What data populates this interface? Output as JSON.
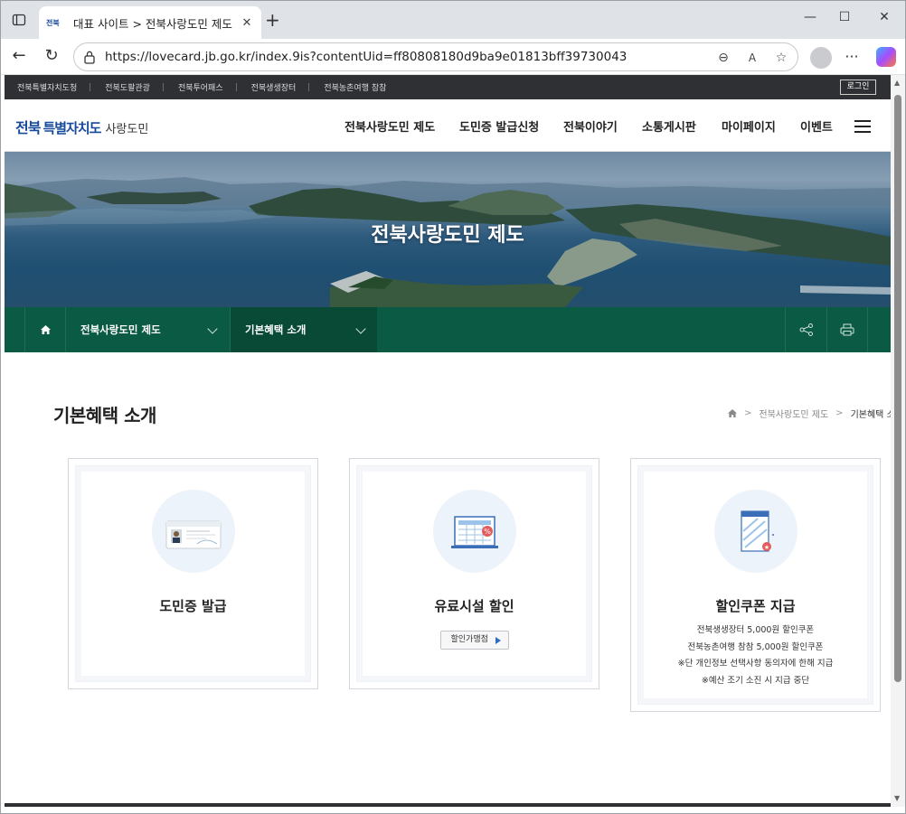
{
  "browser": {
    "tab_title": "대표 사이트 > 전북사랑도민 제도",
    "tab_favicon_text": "전북",
    "url": "https://lovecard.jb.go.kr/index.9is?contentUid=ff80808180d9ba9e01813bff39730043"
  },
  "topbar": {
    "links": [
      "전북특별자치도청",
      "전북도팔관광",
      "전북투어패스",
      "전북생생장터",
      "전북농촌여행 참참"
    ],
    "login_label": "로그인"
  },
  "header": {
    "logo_part1": "전북",
    "logo_part2": "특별자치도",
    "logo_part3": "사랑도민",
    "menu": [
      "전북사랑도민 제도",
      "도민증 발급신청",
      "전북이야기",
      "소통게시판",
      "마이페이지",
      "이벤트"
    ]
  },
  "hero": {
    "title": "전북사랑도민 제도"
  },
  "subnav": {
    "depth1": "전북사랑도민 제도",
    "depth2": "기본혜택 소개"
  },
  "content": {
    "title": "기본혜택 소개",
    "breadcrumb": [
      "전북사랑도민 제도",
      "기본혜택 소"
    ]
  },
  "cards": [
    {
      "title": "도민증 발급",
      "icon": "id-card-icon"
    },
    {
      "title": "유료시설 할인",
      "icon": "discount-screen-icon",
      "button_label": "할인가맹점"
    },
    {
      "title": "할인쿠폰 지급",
      "icon": "coupon-icon",
      "desc": [
        "전북생생장터 5,000원 할인쿠폰",
        "전북농촌여행 참참 5,000원 할인쿠폰",
        "※단 개인정보 선택사항 동의자에 한해 지급",
        "※예산 조기 소진 시 지급 중단"
      ]
    }
  ],
  "colors": {
    "brand_blue": "#174a9c",
    "subnav_green": "#0b5a43",
    "topbar_dark": "#2e3034"
  }
}
